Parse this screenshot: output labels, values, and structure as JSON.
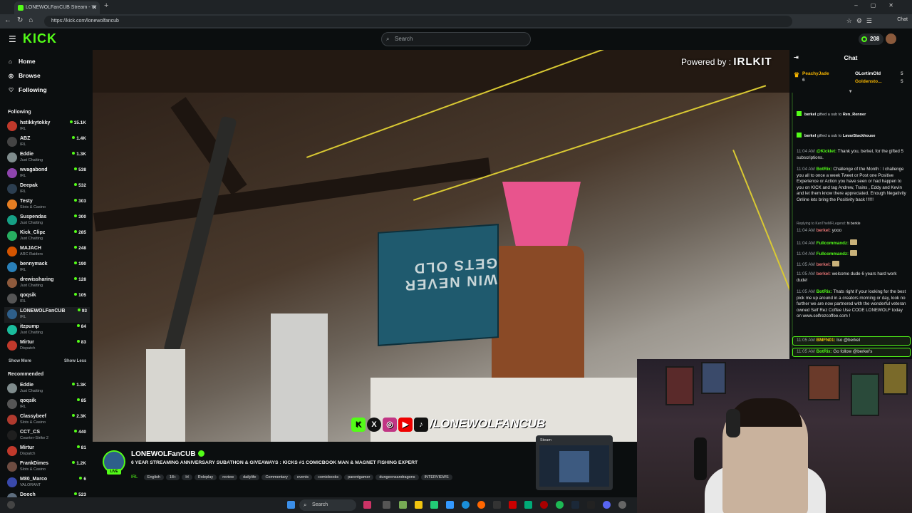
{
  "browser": {
    "tab_title": "LONEWOLFanCUB Stream - W",
    "url": "https://kick.com/lonewolfancub",
    "chat_button": "Chat"
  },
  "header": {
    "logo": "KICK",
    "search_placeholder": "Search",
    "points": "208"
  },
  "sidebar": {
    "nav": [
      {
        "label": "Home",
        "icon": "home-icon"
      },
      {
        "label": "Browse",
        "icon": "compass-icon"
      },
      {
        "label": "Following",
        "icon": "heart-icon"
      }
    ],
    "following_title": "Following",
    "following": [
      {
        "name": "hstikkytokky",
        "category": "IRL",
        "viewers": "15.1K",
        "color": "#c0392b"
      },
      {
        "name": "ABZ",
        "category": "IRL",
        "viewers": "1.4K",
        "color": "#444444"
      },
      {
        "name": "Eddie",
        "category": "Just Chatting",
        "viewers": "1.3K",
        "color": "#7f8c8d"
      },
      {
        "name": "wvagabond",
        "category": "IRL",
        "viewers": "538",
        "color": "#8e44ad"
      },
      {
        "name": "Deepak",
        "category": "IRL",
        "viewers": "532",
        "color": "#2c3e50"
      },
      {
        "name": "Testy",
        "category": "Slots & Casino",
        "viewers": "303",
        "color": "#e67e22"
      },
      {
        "name": "Suspendas",
        "category": "Just Chatting",
        "viewers": "300",
        "color": "#16a085"
      },
      {
        "name": "Kick_Clipz",
        "category": "Just Chatting",
        "viewers": "285",
        "color": "#27ae60"
      },
      {
        "name": "MAJACH",
        "category": "ARC Raiders",
        "viewers": "248",
        "color": "#d35400"
      },
      {
        "name": "bennymack",
        "category": "IRL",
        "viewers": "190",
        "color": "#2980b9"
      },
      {
        "name": "drewissharing",
        "category": "Just Chatting",
        "viewers": "128",
        "color": "#8e5a3c"
      },
      {
        "name": "qoqsik",
        "category": "IRL",
        "viewers": "105",
        "color": "#555555"
      },
      {
        "name": "LONEWOLFanCUB",
        "category": "IRL",
        "viewers": "93",
        "color": "#2e5f8a",
        "active": true
      },
      {
        "name": "itzpump",
        "category": "Just Chatting",
        "viewers": "84",
        "color": "#1abc9c"
      },
      {
        "name": "Mirtur",
        "category": "Dispatch",
        "viewers": "83",
        "color": "#c0392b"
      }
    ],
    "show_more": "Show More",
    "show_less": "Show Less",
    "recommended_title": "Recommended",
    "recommended": [
      {
        "name": "Eddie",
        "category": "Just Chatting",
        "viewers": "1.3K",
        "color": "#7f8c8d"
      },
      {
        "name": "qoqsik",
        "category": "IRL",
        "viewers": "85",
        "color": "#555555"
      },
      {
        "name": "Classybeef",
        "category": "Slots & Casino",
        "viewers": "2.3K",
        "color": "#b03a2e"
      },
      {
        "name": "CCT_CS",
        "category": "Counter-Strike 2",
        "viewers": "440",
        "color": "#1f1f1f"
      },
      {
        "name": "Mirtur",
        "category": "Dispatch",
        "viewers": "81",
        "color": "#c0392b"
      },
      {
        "name": "FrankDimes",
        "category": "Slots & Casino",
        "viewers": "1.2K",
        "color": "#6d4c41"
      },
      {
        "name": "M80_Marco",
        "category": "VALORANT",
        "viewers": "6",
        "color": "#3949ab"
      },
      {
        "name": "Dooch",
        "category": "",
        "viewers": "523",
        "color": "#5d6d7e"
      }
    ]
  },
  "video": {
    "powered_by": "Powered by :",
    "irlkit": "IRLKIT",
    "box_text": "WIN NEVER GETS OLD",
    "overlay_handle": "/LONEWOLFANCUB"
  },
  "chat": {
    "title": "Chat",
    "leaderboard": [
      {
        "name": "PeachyJade",
        "count": "6"
      },
      {
        "name": "OLortimOld",
        "count": "5"
      },
      {
        "name": "Goldensto...",
        "count": "5"
      }
    ],
    "gifts": [
      {
        "user": "berkel",
        "text": "gifted a sub to",
        "target": "Ren_Renner"
      },
      {
        "user": "berkel",
        "text": "gifted a sub to",
        "target": "LavarStackhouse"
      }
    ],
    "messages": [
      {
        "time": "11:04 AM",
        "user": "@Kicklet",
        "color": "#53fc18",
        "text": "Thank you, berkel, for the gifted 5 subscriptions."
      },
      {
        "time": "11:04 AM",
        "user": "BotRix",
        "color": "#53fc18",
        "text": "Challenge of the Month : I challenge you all to once a week Tweet or Post one Positive Experience or Action you have seen or had happen to you on KICK and tag Andrew, Trains , Eddy and Kevin and let them know there appreciated. Enough Negativity Online lets bring the Positivity back !!!!!!"
      },
      {
        "time": "",
        "user": "Replying to KenTheMFLegend:",
        "color": "#9aa0a4",
        "text": "hi berkle"
      },
      {
        "time": "11:04 AM",
        "user": "berkel",
        "color": "#e57373",
        "text": "yooo"
      },
      {
        "time": "11:04 AM",
        "user": "Fullcommandz",
        "color": "#53fc18",
        "text": ""
      },
      {
        "time": "11:04 AM",
        "user": "Fullcommandz",
        "color": "#53fc18",
        "text": ""
      },
      {
        "time": "11:05 AM",
        "user": "berkel",
        "color": "#e57373",
        "text": ""
      },
      {
        "time": "11:05 AM",
        "user": "berkel",
        "color": "#e57373",
        "text": "welcome dude 6 years hard work dude!"
      },
      {
        "time": "11:05 AM",
        "user": "BotRix",
        "color": "#53fc18",
        "text": "Thats right if your looking for the best pick me up around in a creators morning or day, look no further we are now partnered with the wonderful veteran owned Self Rez Coffee Use CODE LONEWOLF today on www.selfrezcoffee.com !"
      },
      {
        "time": "11:05 AM",
        "user": "BMFN01",
        "color": "#f1c40f",
        "text": "lso @berkel"
      },
      {
        "time": "11:05 AM",
        "user": "BotRix",
        "color": "#53fc18",
        "text": "Go follow @berkel's"
      }
    ]
  },
  "stream": {
    "name": "LONEWOLFanCUB",
    "live": "LIVE",
    "title": "6 YEAR STREAMING ANNIVERSARY SUBATHON & GIVEAWAYS : KICKS #1 COMICBOOK MAN & MAGNET FISHING EXPERT",
    "category": "IRL",
    "tags": [
      "English",
      "18+",
      "Irl",
      "Roleplay",
      "review",
      "dailylife",
      "Commentary",
      "events",
      "comicbooks",
      "parentgamer",
      "dungeonsandragons",
      "INTERVIEWS"
    ]
  },
  "steam_popup": {
    "label": "Steam"
  },
  "taskbar": {
    "search": "Search"
  }
}
